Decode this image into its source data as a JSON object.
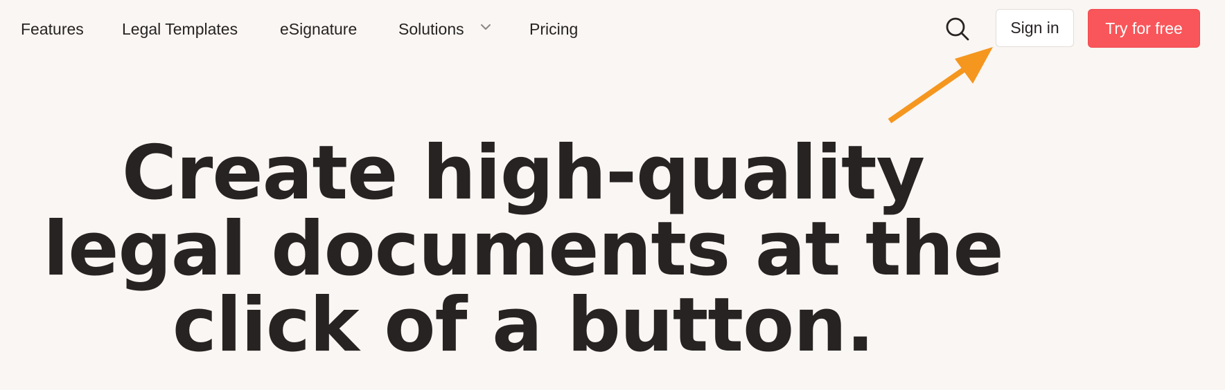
{
  "nav": {
    "items": [
      {
        "label": "Features"
      },
      {
        "label": "Legal Templates"
      },
      {
        "label": "eSignature"
      },
      {
        "label": "Solutions",
        "has_dropdown": true
      },
      {
        "label": "Pricing"
      }
    ]
  },
  "header": {
    "search_icon": "search-icon",
    "sign_in_label": "Sign in",
    "try_free_label": "Try for free"
  },
  "hero": {
    "line1": "Create high-quality",
    "line2": "legal documents at the",
    "line3": "click of a button."
  },
  "annotation": {
    "arrow_color": "#f5961f"
  },
  "colors": {
    "background": "#f9f6f3",
    "text": "#272322",
    "accent": "#f8565a"
  }
}
